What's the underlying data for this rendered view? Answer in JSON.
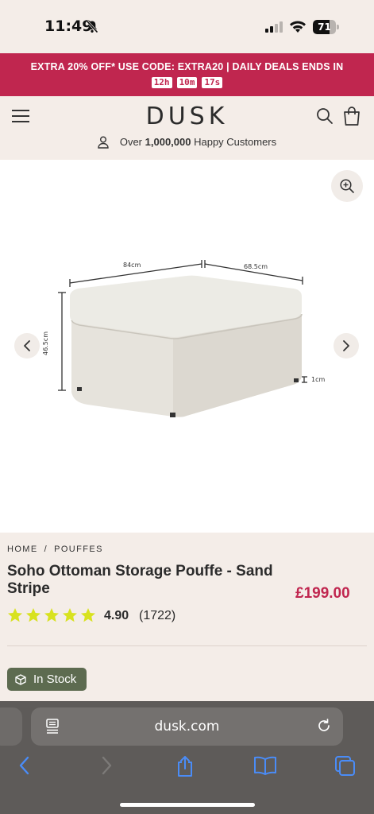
{
  "status_bar": {
    "time": "11:49",
    "battery": "71",
    "battery_level": 0.71
  },
  "promo": {
    "line": "EXTRA 20% OFF* USE CODE: EXTRA20 |  DAILY DEALS ENDS IN",
    "timers": [
      "12h",
      "10m",
      "17s"
    ]
  },
  "header": {
    "logo": "DUSK"
  },
  "customers": {
    "prefix": "Over ",
    "count": "1,000,000",
    "suffix": " Happy Customers"
  },
  "gallery": {
    "dimensions": {
      "width": "84cm",
      "depth": "68.5cm",
      "height": "46.5cm",
      "leg": "1cm"
    }
  },
  "breadcrumb": [
    "HOME",
    "POUFFES"
  ],
  "product": {
    "title": "Soho Ottoman Storage Pouffe - Sand Stripe",
    "price": "£199.00",
    "rating": "4.90",
    "review_count": "(1722)",
    "stars": 5,
    "stock": "In Stock"
  },
  "browser": {
    "url": "dusk.com"
  },
  "colors": {
    "brand": "#c0264f",
    "background": "#f4ede8",
    "stock": "#5d6b50",
    "star": "#d8e21f"
  }
}
